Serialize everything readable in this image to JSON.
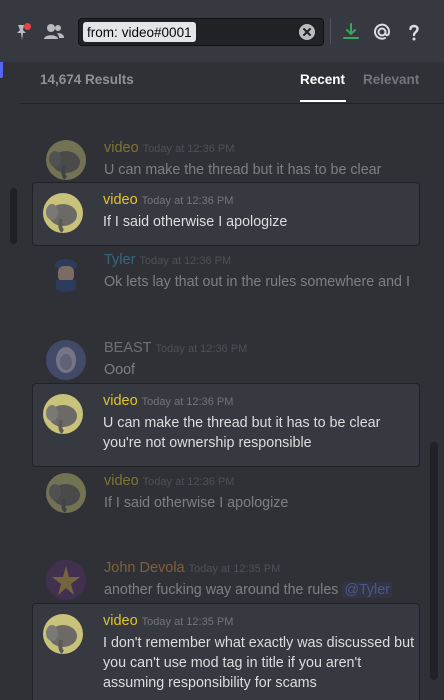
{
  "toolbar": {
    "search_prefix": "from:",
    "search_value": "video#0001",
    "icons": [
      "pin-icon",
      "members-icon",
      "clear-icon",
      "inbox-download-icon",
      "mention-icon",
      "help-icon"
    ]
  },
  "results": {
    "count": "14,674 Results",
    "tabs": [
      {
        "label": "Recent",
        "active": true
      },
      {
        "label": "Relevant",
        "active": false
      }
    ]
  },
  "messages": [
    {
      "author": "video",
      "time": "Today at 12:36 PM",
      "lines": [
        "U can make the thread but it has to be clear"
      ],
      "highlight": false
    },
    {
      "author": "video",
      "time": "Today at 12:36 PM",
      "lines": [
        "If I said otherwise I apologize"
      ],
      "highlight": true
    },
    {
      "author": "Tyler",
      "time": "Today at 12:36 PM",
      "lines": [
        "Ok lets lay that out in the rules somewhere and I"
      ],
      "highlight": false
    },
    {
      "author": "BEAST",
      "time": "Today at 12:36 PM",
      "lines": [
        "Ooof"
      ],
      "highlight": false
    },
    {
      "author": "video",
      "time": "Today at 12:36 PM",
      "lines": [
        "U can make the thread but it has to be clear",
        "you're not ownership responsible"
      ],
      "highlight": true
    },
    {
      "author": "video",
      "time": "Today at 12:36 PM",
      "lines": [
        "If I said otherwise I apologize"
      ],
      "highlight": false
    },
    {
      "author": "John Devola",
      "time": "Today at 12:35 PM",
      "lines": [
        "another fucking way around the rules"
      ],
      "mention": "@Tyler",
      "highlight": false
    },
    {
      "author": "video",
      "time": "Today at 12:35 PM",
      "lines": [
        "I don't remember what exactly was discussed but",
        "you can't use mod tag in title if you aren't",
        "assuming responsibility for scams"
      ],
      "highlight": true
    }
  ],
  "colors": {
    "accent": "#5865f2",
    "video_name": "#e2c42c",
    "tyler_name": "#3ea6d8",
    "john_name": "#e0993a",
    "download_icon": "#3ba55c"
  }
}
